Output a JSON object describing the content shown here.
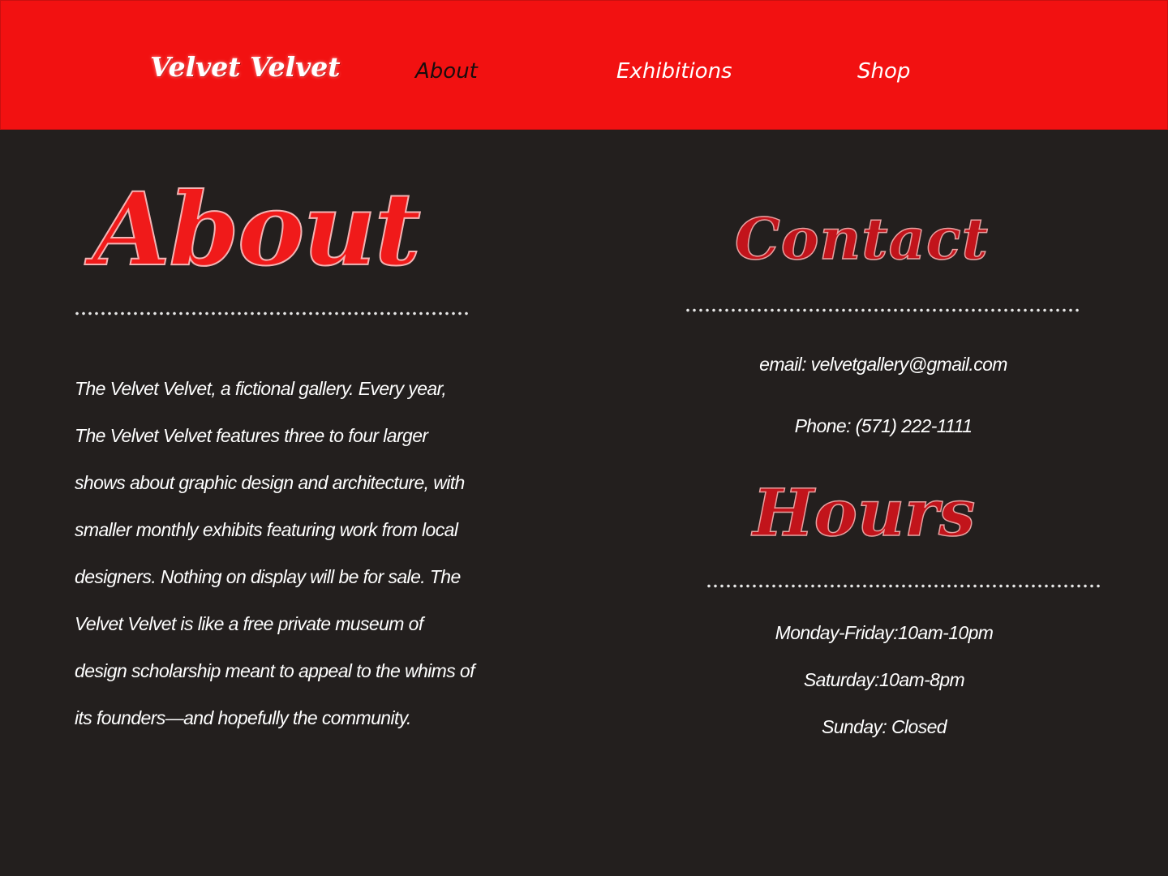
{
  "header": {
    "brand": "Velvet Velvet",
    "nav": [
      {
        "label": "About"
      },
      {
        "label": "Exhibitions"
      },
      {
        "label": "Shop"
      }
    ],
    "colors": {
      "background": "#f21111",
      "active_link": "#1a0d0d",
      "link": "#ffffff"
    }
  },
  "about": {
    "heading": "About",
    "lines": [
      "The Velvet Velvet, a fictional gallery. Every year,",
      "The Velvet Velvet features three to four larger",
      "shows about graphic design and architecture, with",
      "smaller monthly exhibits featuring work from local",
      "designers. Nothing on display will be for sale. The",
      "Velvet Velvet is like a free private museum of",
      "design scholarship meant to appeal to the whims of",
      "its founders—and hopefully the community."
    ]
  },
  "contact": {
    "heading": "Contact",
    "email": "email: velvetgallery@gmail.com",
    "phone": "Phone: (571) 222-1111"
  },
  "hours": {
    "heading": "Hours",
    "lines": [
      "Monday-Friday:10am-10pm",
      "Saturday:10am-8pm",
      "Sunday: Closed"
    ]
  },
  "colors": {
    "page_background": "#231f1e",
    "heading_red": "#d8141b"
  }
}
